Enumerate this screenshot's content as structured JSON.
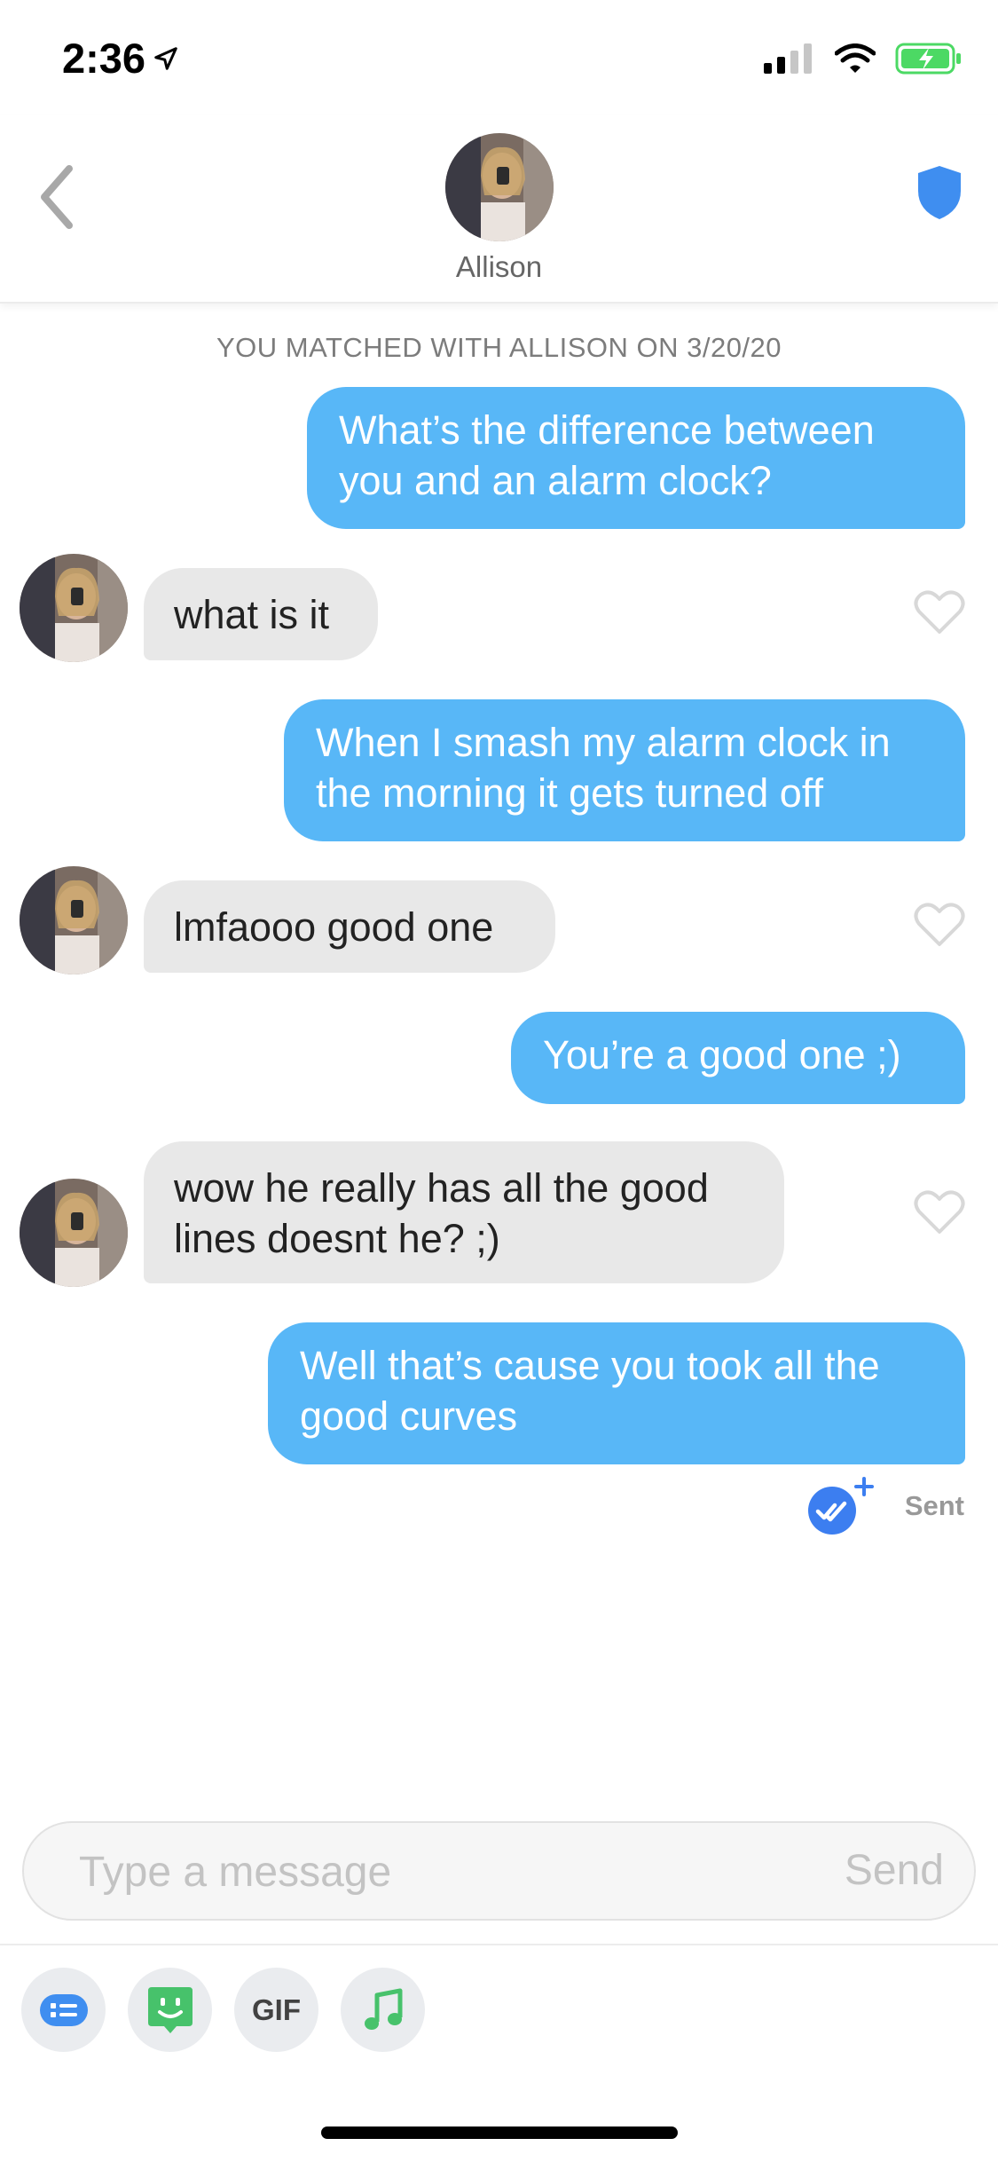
{
  "status_bar": {
    "time": "2:36"
  },
  "header": {
    "name": "Allison"
  },
  "match_notice": "YOU MATCHED WITH ALLISON ON 3/20/20",
  "messages": [
    {
      "from": "me",
      "text": "What’s the difference between you and an alarm clock?"
    },
    {
      "from": "them",
      "text": "what is it"
    },
    {
      "from": "me",
      "text": "When I smash my alarm clock in the morning it gets turned off"
    },
    {
      "from": "them",
      "text": "lmfaooo good one"
    },
    {
      "from": "me",
      "text": "You’re a good one ;)"
    },
    {
      "from": "them",
      "text": "wow he really has all the good lines doesnt he? ;)"
    },
    {
      "from": "me",
      "text": "Well that’s cause you took all the good curves"
    }
  ],
  "read_receipt": {
    "label": "Sent"
  },
  "composer": {
    "placeholder": "Type a message",
    "send_label": "Send"
  },
  "toolbar": {
    "gif_label": "GIF"
  },
  "icons": [
    "back-chevron-icon",
    "shield-icon",
    "heart-icon",
    "read-receipt-icon",
    "signal-icon",
    "wifi-icon",
    "battery-icon",
    "location-arrow-icon",
    "chat-icon",
    "sticker-icon",
    "music-icon"
  ],
  "colors": {
    "outgoing_bubble": "#58b7f7",
    "incoming_bubble": "#e8e8e8",
    "accent": "#3c7ef0"
  }
}
